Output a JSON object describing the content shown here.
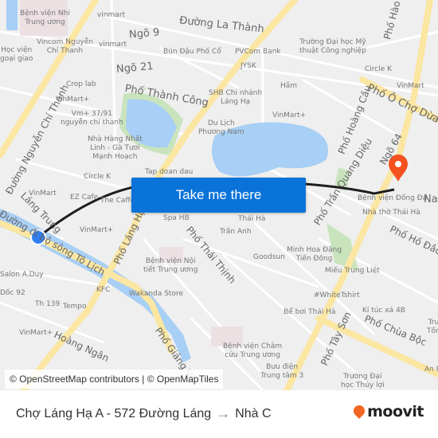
{
  "map": {
    "labels": {
      "benh_vien_nhi": "Bệnh viện Nhi\nTrung ương",
      "vinmart_top": "vinmart",
      "ngo_9": "Ngõ 9",
      "duong_la_thanh": "Đường La Thành",
      "vincom": "Vincom Nguyễn\nChí Thanh",
      "vinmart_2": "vinmart",
      "hoc_vien": "Học viện\ngoại giao",
      "bun_dau": "Bún Đậu Phố Cổ",
      "pvcom": "PVCom Bank",
      "dai_hoc_my_thuat": "Trường Đại học Mỹ\nthuật Công nghiệp",
      "pho_hao": "Phố Hào",
      "ngo_21": "Ngõ 21",
      "jysk": "JYSK",
      "circle_k_top": "Circle K",
      "crop_lab": "Crop lab",
      "pho_thanh_cong": "Phố Thành Công",
      "shb": "SHB Chi nhánh\nLáng Hạ",
      "ham": "Hầm",
      "vinmart_right": "VinMart",
      "vinmart_plus_1": "VinMart+",
      "vm_3791": "Vm+ 37/91\nnguyễn chí thanh",
      "nguyen_chi_thanh": "Đường Nguyễn Chí Thanh",
      "pho_o_cho_dua": "Phố Ô Chợ Dừa",
      "vinmart_plus_lake": "VinMart+",
      "pho_hoang_cau": "Phố Hoàng Cầu",
      "nha_hang": "Nhà Hàng Nhất\nLinh - Gà Tươi\nMạnh Hoạch",
      "du_lich": "Du Lịch\nPhương Nam",
      "tap_doan_dau": "Tap doan dau",
      "circle_k_2": "Circle K",
      "pho_tran_quang_dieu": "Phố Trần Quang Diệu",
      "ngo_64": "Ngõ 64",
      "vinmart_left": "VinMart",
      "ez_cafe": "EZ Cafe",
      "the_caffe": "The Caffe",
      "benh_vien_dong_da": "Bệnh viện Đống Đa",
      "na": "Na",
      "lang_trung": "Láng Trung",
      "nha_tho_thai_ha": "Nhà thờ Thái Hà",
      "spa_hb": "Spa HB",
      "thai_ha": "Thái Hà",
      "vinmart_plus_2": "VinMart+",
      "pho_lang_ha": "Phố Láng Hạ",
      "duong_to_lich": "Đường đi bộ sông Tô Lịch",
      "tran_anh": "Trần Anh",
      "pho_thai_thinh": "Phố Thái Thịnh",
      "pho_ho_dac_di": "Phố Hồ Đắc Di",
      "minh_hoa": "Minh Hoa Đặng\nTiến Đông",
      "goodsun": "Goodsun",
      "benh_vien_noi_tiet": "Bệnh viện Nội\ntiết Trung ương",
      "salon": "Salon A.Duy",
      "mieu_trung_liet": "Miếu Trung Liệt",
      "doc_92": "Dốc 92",
      "kfc": "KFC",
      "wakanda": "Wakanda Store",
      "white_tshirt": "#WhiteTshirt",
      "th_139": "Th 139",
      "tempo": "Tempo",
      "be_boi": "Bể bơi Thái Hà",
      "ki_tuc_xa": "Kí túc xá 4B",
      "vinmart_plus_3": "VinMart+",
      "pho_tay_son": "Phố Tây Sơn",
      "pho_chua_boc": "Phố Chùa Bộc",
      "hoang_ngan": "Hoàng Ngân",
      "benh_vien_cham_cuu": "Bệnh viện Châm\ncứu Trung ương",
      "pho_giang_vo": "Phố Giảng Võ",
      "an_p": "An P",
      "buu_dien": "Bưu điện\nTrung tâm 3",
      "truong_thuy_loi": "Trường Đại\nhọc Thủy lợi",
      "tru": "Tru\nTốn"
    },
    "origin_marker": {
      "name": "Chợ Láng Hạ A - 572 Đường Láng",
      "color": "#2f7ff0"
    },
    "destination_marker": {
      "name": "Nhà C",
      "color": "#f4511e"
    },
    "cta_label": "Take me there",
    "attribution": "© OpenStreetMap contributors | © OpenMapTiles"
  },
  "footer": {
    "origin": "Chợ Láng Hạ A - 572 Đường Láng",
    "arrow": "→",
    "destination": "Nhà C",
    "brand": "moovit",
    "brand_color": "#f26522"
  }
}
